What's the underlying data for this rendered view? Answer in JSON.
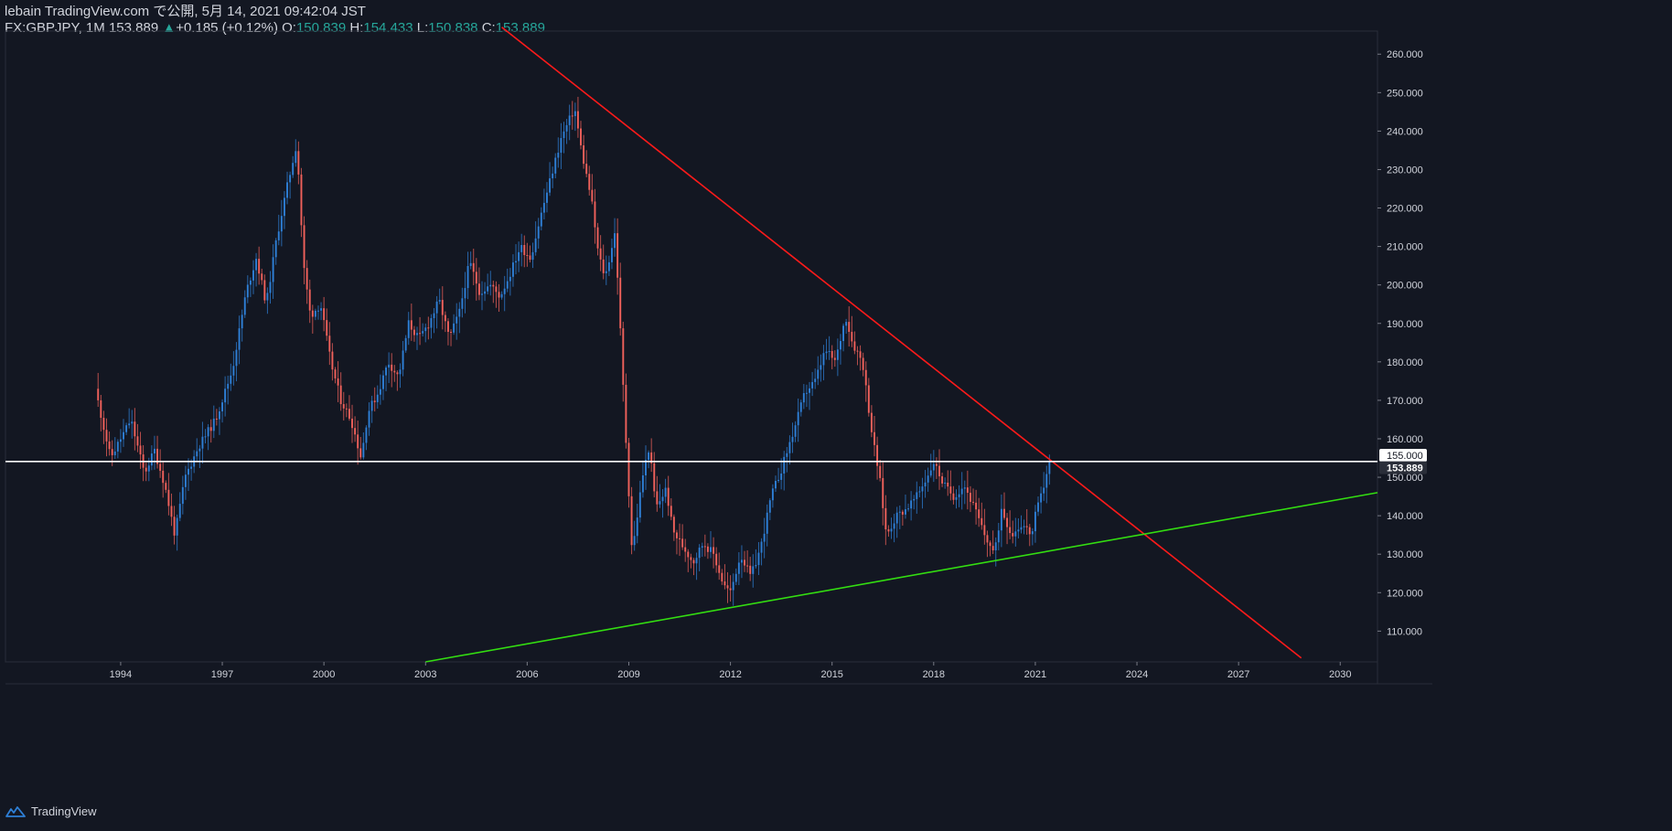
{
  "header": {
    "line1": "lebain TradingView.com で公開, 5月 14, 2021 09:42:04 JST",
    "symbol": "FX:GBPJPY, 1M",
    "last": "153.889",
    "change_arrow": "▲",
    "change": "+0.185 (+0.12%)",
    "o_label": "O:",
    "o_val": "150.839",
    "h_label": "H:",
    "h_val": "154.433",
    "l_label": "L:",
    "l_val": "150.838",
    "c_label": "C:",
    "c_val": "153.889"
  },
  "footer": {
    "brand": "TradingView",
    "logo_icon": "tradingview-logo-icon"
  },
  "colors": {
    "background": "#131722",
    "up": "#2e7fd6",
    "down": "#f0615b",
    "resistance": "#ff1a1a",
    "support": "#33dd11",
    "level": "#ffffff",
    "text": "#d1d4dc"
  },
  "chart_data": {
    "type": "candlestick",
    "symbol": "FX:GBPJPY",
    "interval": "1M",
    "ylim": [
      102,
      266
    ],
    "xlim": [
      1990.6,
      2031.1
    ],
    "x_ticks": [
      "1994",
      "1997",
      "2000",
      "2003",
      "2006",
      "2009",
      "2012",
      "2015",
      "2018",
      "2021",
      "2024",
      "2027",
      "2030"
    ],
    "y_ticks": [
      "110.000",
      "120.000",
      "130.000",
      "140.000",
      "150.000",
      "160.000",
      "170.000",
      "180.000",
      "190.000",
      "200.000",
      "210.000",
      "220.000",
      "230.000",
      "240.000",
      "250.000",
      "260.000"
    ],
    "price_labels": [
      {
        "text": "155.000",
        "value": 155.0,
        "style": "level"
      },
      {
        "text": "153.889",
        "value": 153.889,
        "style": "last"
      }
    ],
    "path": [
      [
        1993.25,
        173
      ],
      [
        1993.7,
        155
      ],
      [
        1994.0,
        160
      ],
      [
        1994.3,
        165
      ],
      [
        1994.7,
        151
      ],
      [
        1995.0,
        157
      ],
      [
        1995.3,
        148
      ],
      [
        1995.6,
        135
      ],
      [
        1995.9,
        150
      ],
      [
        1996.3,
        158
      ],
      [
        1996.8,
        165
      ],
      [
        1997.3,
        178
      ],
      [
        1997.7,
        198
      ],
      [
        1998.0,
        207
      ],
      [
        1998.3,
        195
      ],
      [
        1998.6,
        212
      ],
      [
        1998.9,
        225
      ],
      [
        1999.2,
        237
      ],
      [
        1999.4,
        205
      ],
      [
        1999.6,
        192
      ],
      [
        1999.9,
        195
      ],
      [
        2000.2,
        180
      ],
      [
        2000.5,
        170
      ],
      [
        2000.8,
        165
      ],
      [
        2001.1,
        155
      ],
      [
        2001.3,
        167
      ],
      [
        2001.6,
        172
      ],
      [
        2001.9,
        180
      ],
      [
        2002.2,
        176
      ],
      [
        2002.5,
        190
      ],
      [
        2002.8,
        186
      ],
      [
        2003.1,
        190
      ],
      [
        2003.4,
        196
      ],
      [
        2003.7,
        186
      ],
      [
        2004.0,
        193
      ],
      [
        2004.3,
        206
      ],
      [
        2004.6,
        198
      ],
      [
        2004.9,
        200
      ],
      [
        2005.2,
        197
      ],
      [
        2005.5,
        203
      ],
      [
        2005.8,
        210
      ],
      [
        2006.1,
        207
      ],
      [
        2006.4,
        218
      ],
      [
        2006.7,
        228
      ],
      [
        2007.0,
        238
      ],
      [
        2007.4,
        246
      ],
      [
        2007.6,
        235
      ],
      [
        2007.9,
        222
      ],
      [
        2008.1,
        208
      ],
      [
        2008.3,
        202
      ],
      [
        2008.6,
        214
      ],
      [
        2008.9,
        162
      ],
      [
        2009.1,
        130
      ],
      [
        2009.4,
        150
      ],
      [
        2009.6,
        158
      ],
      [
        2009.8,
        142
      ],
      [
        2010.1,
        147
      ],
      [
        2010.3,
        136
      ],
      [
        2010.6,
        132
      ],
      [
        2010.9,
        128
      ],
      [
        2011.2,
        133
      ],
      [
        2011.5,
        130
      ],
      [
        2011.8,
        122
      ],
      [
        2012.0,
        120
      ],
      [
        2012.3,
        130
      ],
      [
        2012.6,
        124
      ],
      [
        2012.9,
        132
      ],
      [
        2013.2,
        145
      ],
      [
        2013.5,
        152
      ],
      [
        2013.9,
        163
      ],
      [
        2014.2,
        172
      ],
      [
        2014.5,
        175
      ],
      [
        2014.8,
        183
      ],
      [
        2015.1,
        180
      ],
      [
        2015.4,
        192
      ],
      [
        2015.6,
        185
      ],
      [
        2015.9,
        180
      ],
      [
        2016.2,
        160
      ],
      [
        2016.4,
        150
      ],
      [
        2016.6,
        135
      ],
      [
        2016.9,
        140
      ],
      [
        2017.2,
        142
      ],
      [
        2017.5,
        145
      ],
      [
        2017.8,
        150
      ],
      [
        2018.0,
        154
      ],
      [
        2018.3,
        148
      ],
      [
        2018.6,
        145
      ],
      [
        2018.9,
        148
      ],
      [
        2019.2,
        142
      ],
      [
        2019.5,
        135
      ],
      [
        2019.8,
        130
      ],
      [
        2020.0,
        142
      ],
      [
        2020.3,
        135
      ],
      [
        2020.6,
        138
      ],
      [
        2020.9,
        135
      ],
      [
        2021.0,
        140
      ],
      [
        2021.2,
        146
      ],
      [
        2021.4,
        153.889
      ]
    ],
    "trendlines": [
      {
        "name": "resistance",
        "color": "#ff1a1a",
        "points": [
          [
            2005.25,
            267
          ],
          [
            2028.85,
            103
          ]
        ]
      },
      {
        "name": "support",
        "color": "#33dd11",
        "points": [
          [
            2003.0,
            102
          ],
          [
            2031.1,
            146
          ]
        ]
      },
      {
        "name": "horizontal-level",
        "color": "#ffffff",
        "points": [
          [
            1990.6,
            154.1
          ],
          [
            2031.1,
            154.1
          ]
        ]
      }
    ]
  }
}
